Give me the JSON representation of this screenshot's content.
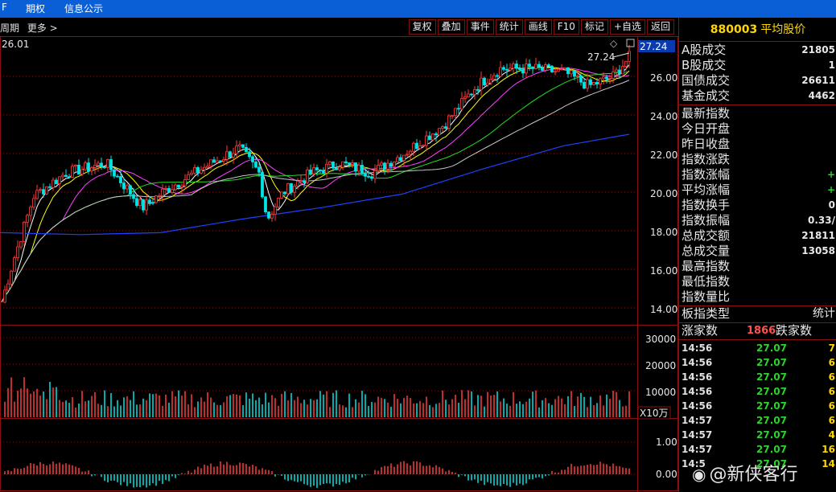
{
  "menubar": {
    "items": [
      "F",
      "期权",
      "信息公示"
    ]
  },
  "period_bar": {
    "period_label": "周期",
    "more_label": "更多 >"
  },
  "toolbar": {
    "buttons": [
      "复权",
      "叠加",
      "事件",
      "统计",
      "画线",
      "F10",
      "标记",
      "+自选",
      "返回"
    ]
  },
  "main_chart": {
    "top_left_value": "26.01",
    "latest_price_badge": "27.24",
    "peak_annotation": "27.24",
    "price_labels": [
      "26.00",
      "24.00",
      "22.00",
      "20.00",
      "18.00",
      "16.00",
      "14.00"
    ]
  },
  "volume_chart": {
    "labels": [
      "30000",
      "20000",
      "10000"
    ],
    "unit_badge": "X10万"
  },
  "macd_chart": {
    "labels": [
      "1.00",
      "0.00"
    ]
  },
  "panel": {
    "code": "880003",
    "name": "平均股价",
    "stats1": [
      {
        "label": "A股成交",
        "value": "21805"
      },
      {
        "label": "B股成交",
        "value": "1"
      },
      {
        "label": "国债成交",
        "value": "26611"
      },
      {
        "label": "基金成交",
        "value": "4462"
      }
    ],
    "stats2": [
      {
        "label": "最新指数",
        "value": ""
      },
      {
        "label": "今日开盘",
        "value": ""
      },
      {
        "label": "昨日收盘",
        "value": ""
      },
      {
        "label": "指数涨跌",
        "value": ""
      },
      {
        "label": "指数涨幅",
        "value": "+"
      },
      {
        "label": "平均涨幅",
        "value": "+"
      },
      {
        "label": "指数换手",
        "value": "0"
      },
      {
        "label": "指数振幅",
        "value": "0.33/"
      },
      {
        "label": "总成交额",
        "value": "21811"
      },
      {
        "label": "总成交量",
        "value": "13058"
      },
      {
        "label": "最高指数",
        "value": ""
      },
      {
        "label": "最低指数",
        "value": ""
      },
      {
        "label": "指数量比",
        "value": ""
      }
    ],
    "sector_type_label": "板指类型",
    "sector_type_value": "统计",
    "up_count_label": "涨家数",
    "up_count_value": "1866",
    "down_count_label": "跌家数",
    "ticks": [
      {
        "time": "14:56",
        "price": "27.07",
        "vol": "7"
      },
      {
        "time": "14:56",
        "price": "27.07",
        "vol": "6"
      },
      {
        "time": "14:56",
        "price": "27.07",
        "vol": "6"
      },
      {
        "time": "14:56",
        "price": "27.07",
        "vol": "6"
      },
      {
        "time": "14:56",
        "price": "27.07",
        "vol": "6"
      },
      {
        "time": "14:57",
        "price": "27.07",
        "vol": "6"
      },
      {
        "time": "14:57",
        "price": "27.07",
        "vol": "4"
      },
      {
        "time": "14:57",
        "price": "27.07",
        "vol": "16"
      },
      {
        "time": "14:5",
        "price": "27.07",
        "vol": "14"
      }
    ]
  },
  "watermark": {
    "text": "@新侠客行"
  },
  "colors": {
    "up": "#ff3c3c",
    "down": "#00e5e5",
    "ma_white": "#ffffff",
    "ma_yellow": "#ffff00",
    "ma_magenta": "#ff40ff",
    "ma_green": "#20e020",
    "ma_gray": "#c8c8c8",
    "ma_blue": "#2040ff",
    "grid": "#8a1010"
  }
}
